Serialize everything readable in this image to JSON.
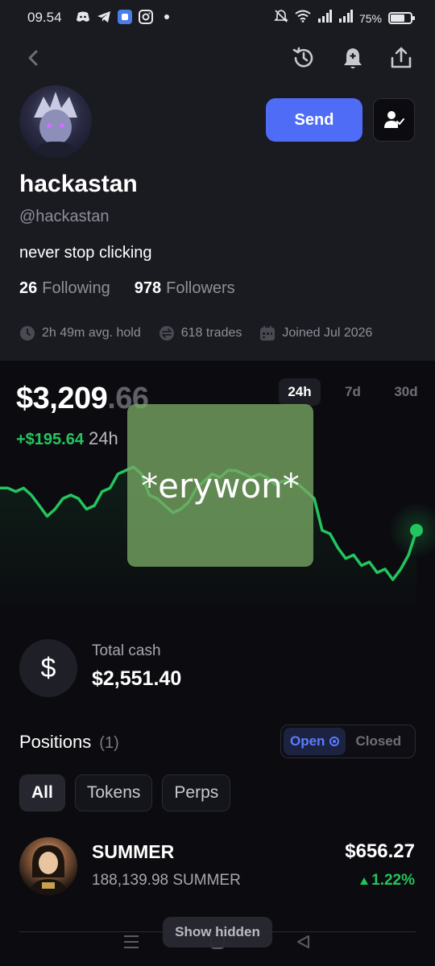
{
  "status_bar": {
    "time": "09.54",
    "battery_text": "75%",
    "battery_level": 0.75,
    "app_icons": [
      "discord-icon",
      "telegram-icon",
      "blue-app-icon",
      "instagram-icon"
    ]
  },
  "header": {
    "icons": [
      "back-icon",
      "history-icon",
      "bell-icon",
      "share-icon"
    ]
  },
  "profile": {
    "name": "hackastan",
    "handle": "@hackastan",
    "bio": "never stop clicking",
    "following_count": "26",
    "following_label": "Following",
    "followers_count": "978",
    "followers_label": "Followers",
    "avg_hold": "2h 49m avg. hold",
    "trades": "618 trades",
    "joined": "Joined Jul 2026",
    "send_label": "Send"
  },
  "portfolio": {
    "value_main": "$3,209",
    "value_cents": ".66",
    "change": "+$195.64",
    "change_period": "24h",
    "ranges": [
      "24h",
      "7d",
      "30d"
    ],
    "active_range": "24h"
  },
  "overlay": {
    "sticker_text": "*erywon*"
  },
  "chart_data": {
    "type": "line",
    "title": "",
    "xlabel": "",
    "ylabel": "",
    "x": [
      0,
      1,
      2,
      3,
      4,
      5,
      6,
      7,
      8,
      9,
      10,
      11,
      12,
      13,
      14,
      15,
      16,
      17,
      18,
      19,
      20,
      21,
      22,
      23,
      24,
      25,
      26,
      27,
      28,
      29,
      30,
      31,
      32,
      33,
      34,
      35,
      36,
      37,
      38,
      39,
      40,
      41,
      42,
      43,
      44,
      45,
      46,
      47,
      48,
      49,
      50,
      51,
      52,
      53
    ],
    "series": [
      {
        "values": [
          3222,
          3222,
          3221,
          3222,
          3220,
          3217,
          3214,
          3216,
          3219,
          3220,
          3219,
          3216,
          3217,
          3221,
          3222,
          3226,
          3227,
          3228,
          3226,
          3220,
          3219,
          3217,
          3215,
          3216,
          3218,
          3222,
          3224,
          3226,
          3225,
          3227,
          3227,
          3226,
          3225,
          3226,
          3225,
          3223,
          3224,
          3224,
          3223,
          3221,
          3219,
          3210,
          3209,
          3205,
          3202,
          3203,
          3200,
          3201,
          3198,
          3199,
          3196,
          3199,
          3203,
          3210
        ]
      }
    ],
    "line_color": "#22c55e",
    "grid": false
  },
  "cash": {
    "label": "Total cash",
    "value": "$2,551.40",
    "symbol": "$"
  },
  "positions": {
    "title": "Positions",
    "count": "(1)",
    "open_label": "Open",
    "closed_label": "Closed",
    "filters": [
      "All",
      "Tokens",
      "Perps"
    ],
    "active_filter": "All",
    "items": [
      {
        "name": "SUMMER",
        "amount": "188,139.98 SUMMER",
        "value": "$656.27",
        "change": "1.22%"
      }
    ],
    "show_hidden_label": "Show hidden"
  },
  "colors": {
    "accent": "#4f6cf6",
    "positive": "#22c55e",
    "background": "#0c0c10",
    "header_bg": "#1a1a21"
  }
}
